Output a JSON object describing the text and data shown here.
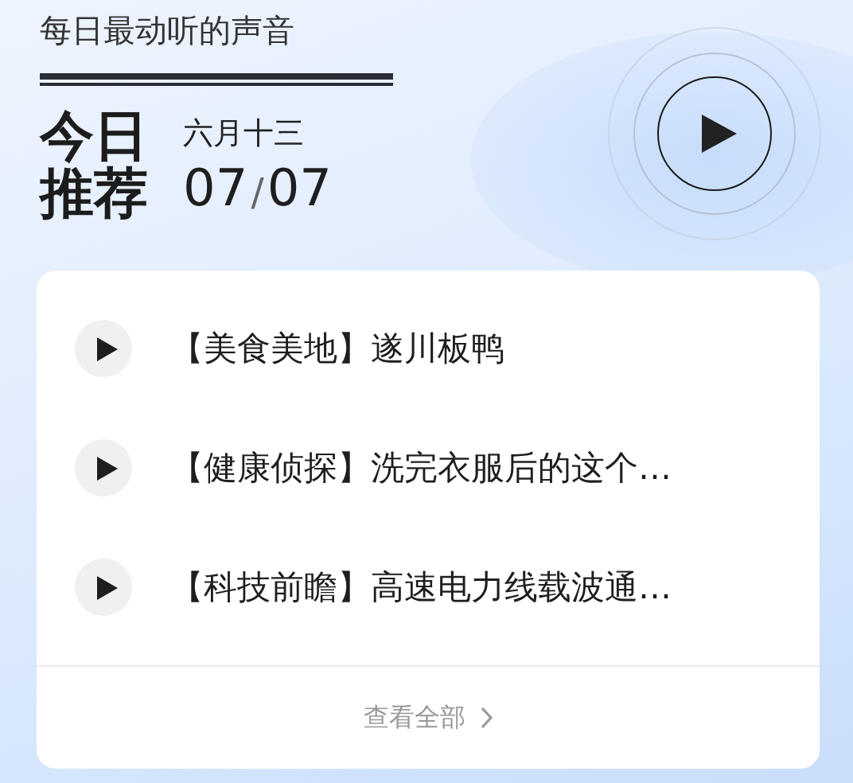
{
  "header": {
    "subtitle": "每日最动听的声音",
    "title_line_1": "今日",
    "title_line_2": "推荐",
    "lunar_date": "六月十三",
    "date_month": "07",
    "date_separator": "/",
    "date_day": "07"
  },
  "playlist": {
    "items": [
      {
        "title": "【美食美地】遂川板鸭"
      },
      {
        "title": "【健康侦探】洗完衣服后的这个…"
      },
      {
        "title": "【科技前瞻】高速电力线载波通…"
      }
    ],
    "view_all": "查看全部"
  }
}
